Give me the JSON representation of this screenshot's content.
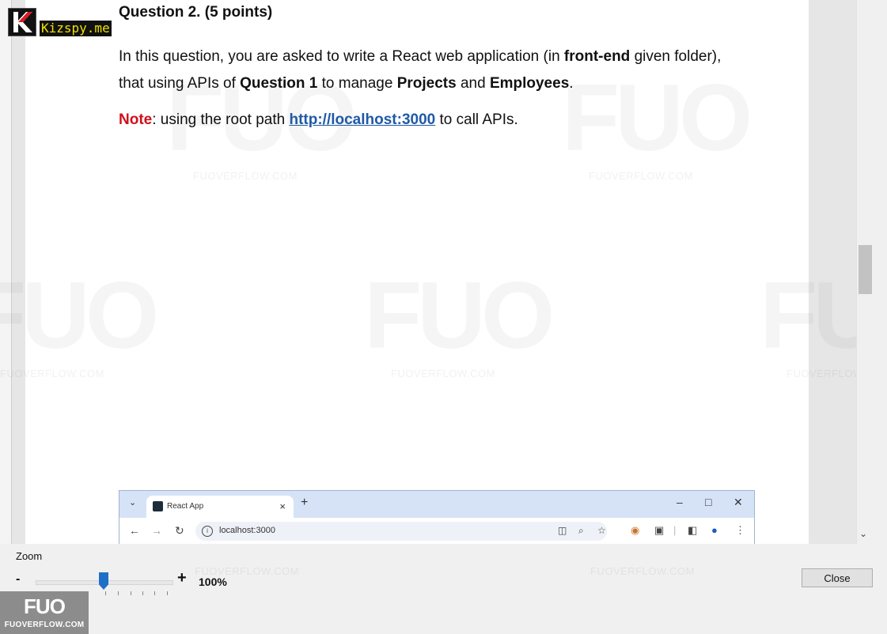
{
  "logo": {
    "text": "Kizspy.me"
  },
  "question": {
    "title": "Question 2. (5 points)",
    "para_line1_a": "In this question, you are asked to write a React web application (in ",
    "para_line1_b": "front-end",
    "para_line1_c": " given folder),",
    "para_line2_a": "that using APIs of ",
    "para_line2_b": "Question 1",
    "para_line2_c": " to manage ",
    "para_line2_d": "Projects",
    "para_line2_e": " and ",
    "para_line2_f": "Employees",
    "para_line2_g": ".",
    "note_label": "Note",
    "note_text_a": ": using the root path ",
    "note_url": "http://localhost:3000",
    "note_text_b": " to call APIs."
  },
  "browser": {
    "tab_title": "React App",
    "tab_close": "×",
    "new_tab": "+",
    "url": "localhost:3000"
  },
  "watermark": {
    "big": "FUO",
    "small": "FUOVERFLOW.COM"
  },
  "zoom": {
    "label": "Zoom",
    "minus": "-",
    "plus": "+",
    "value": "100%",
    "level_percent": 100
  },
  "buttons": {
    "close": "Close"
  },
  "badge": {
    "big": "FUO",
    "small": "FUOVERFLOW.COM"
  }
}
